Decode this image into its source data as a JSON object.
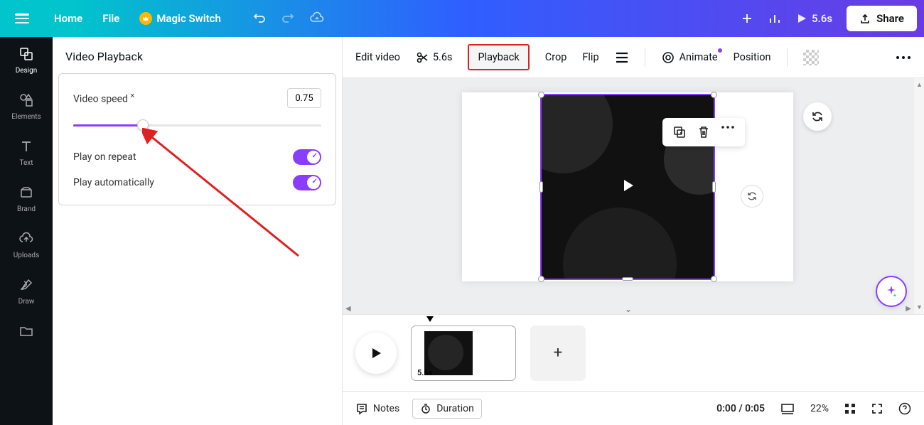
{
  "header": {
    "home": "Home",
    "file": "File",
    "magic_switch": "Magic Switch",
    "duration": "5.6s",
    "share": "Share"
  },
  "sidebar": {
    "items": [
      {
        "label": "Design"
      },
      {
        "label": "Elements"
      },
      {
        "label": "Text"
      },
      {
        "label": "Brand"
      },
      {
        "label": "Uploads"
      },
      {
        "label": "Draw"
      }
    ]
  },
  "panel": {
    "title": "Video Playback",
    "speed_label": "Video speed",
    "speed_suffix": "×",
    "speed_value": "0.75",
    "repeat_label": "Play on repeat",
    "auto_label": "Play automatically"
  },
  "toolbar": {
    "edit_video": "Edit video",
    "clip_duration": "5.6s",
    "playback": "Playback",
    "crop": "Crop",
    "flip": "Flip",
    "animate": "Animate",
    "position": "Position"
  },
  "timeline": {
    "clip_duration": "5.6s"
  },
  "bottom": {
    "notes": "Notes",
    "duration": "Duration",
    "time": "0:00 / 0:05",
    "zoom": "22%"
  }
}
